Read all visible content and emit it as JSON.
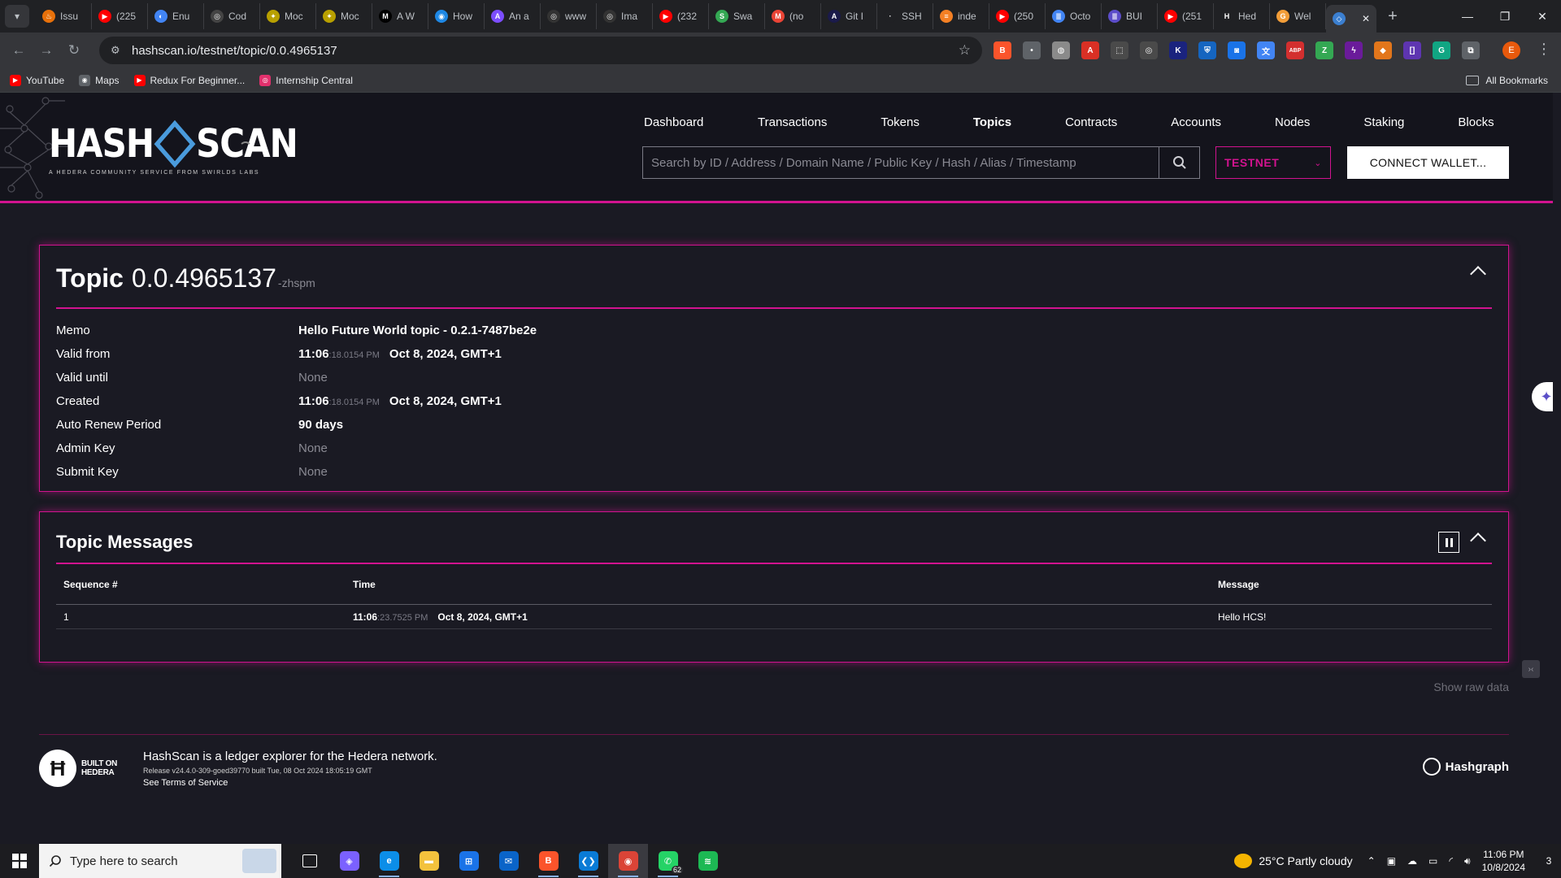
{
  "browser": {
    "tabs": [
      {
        "label": "Issu",
        "color": "#e8710a",
        "glyph": "♨"
      },
      {
        "label": "(225",
        "color": "#ff0000",
        "glyph": "▶"
      },
      {
        "label": "Enu",
        "color": "#4285f4",
        "glyph": "◐"
      },
      {
        "label": "Cod",
        "color": "#444444",
        "glyph": "◎"
      },
      {
        "label": "Moc",
        "color": "#b8a000",
        "glyph": "✦"
      },
      {
        "label": "Moc",
        "color": "#b8a000",
        "glyph": "✦"
      },
      {
        "label": "A W",
        "color": "#000000",
        "glyph": "M"
      },
      {
        "label": "How",
        "color": "#1e88e5",
        "glyph": "◉"
      },
      {
        "label": "An a",
        "color": "#7c4dff",
        "glyph": "A"
      },
      {
        "label": "www",
        "color": "#333333",
        "glyph": "◎"
      },
      {
        "label": "Ima",
        "color": "#333333",
        "glyph": "◎"
      },
      {
        "label": "(232",
        "color": "#ff0000",
        "glyph": "▶"
      },
      {
        "label": "Swa",
        "color": "#34a853",
        "glyph": "S"
      },
      {
        "label": "(no",
        "color": "#ea4335",
        "glyph": "M"
      },
      {
        "label": "Git I",
        "color": "#1a1a4a",
        "glyph": "A"
      },
      {
        "label": "SSH",
        "color": "#202124",
        "glyph": "·"
      },
      {
        "label": "inde",
        "color": "#f48024",
        "glyph": "≡"
      },
      {
        "label": "(250",
        "color": "#ff0000",
        "glyph": "▶"
      },
      {
        "label": "Octo",
        "color": "#4285f4",
        "glyph": "≣"
      },
      {
        "label": "BUI",
        "color": "#5c4dc9",
        "glyph": "≣"
      },
      {
        "label": "(251",
        "color": "#ff0000",
        "glyph": "▶"
      },
      {
        "label": "Hed",
        "color": "#202124",
        "glyph": "H"
      },
      {
        "label": "Wel",
        "color": "#f29d38",
        "glyph": "G"
      },
      {
        "label": "",
        "color": "#3b7fd0",
        "glyph": "◇"
      }
    ],
    "url": "hashscan.io/testnet/topic/0.0.4965137",
    "bookmarks": [
      {
        "label": "YouTube",
        "color": "#ff0000",
        "glyph": "▶"
      },
      {
        "label": "Maps",
        "color": "#5f6368",
        "glyph": "◉"
      },
      {
        "label": "Redux For Beginner...",
        "color": "#ff0000",
        "glyph": "▶"
      },
      {
        "label": "Internship Central",
        "color": "#e1306c",
        "glyph": "◎"
      }
    ],
    "all_bookmarks": "All Bookmarks",
    "extensions": [
      {
        "name": "brave-icon",
        "color": "#fb542b",
        "glyph": "B"
      },
      {
        "name": "extension-dot-icon",
        "color": "#5f6368",
        "glyph": "•"
      },
      {
        "name": "globe-extension-icon",
        "color": "#8a8a8a",
        "glyph": "◍"
      },
      {
        "name": "pdf-icon",
        "color": "#d93025",
        "glyph": "A"
      },
      {
        "name": "screenshot-icon",
        "color": "#4a4a4a",
        "glyph": "⬚"
      },
      {
        "name": "target-icon",
        "color": "#4a4a4a",
        "glyph": "◎"
      },
      {
        "name": "code-extension-icon",
        "color": "#1a237e",
        "glyph": "K"
      },
      {
        "name": "shield-extension-icon",
        "color": "#1565c0",
        "glyph": "⛨"
      },
      {
        "name": "camera-extension-icon",
        "color": "#1a73e8",
        "glyph": "◙"
      },
      {
        "name": "translate-icon",
        "color": "#4285f4",
        "glyph": "文"
      },
      {
        "name": "adblock-icon",
        "color": "#d32f2f",
        "glyph": "ABP"
      },
      {
        "name": "tracker-extension-icon",
        "color": "#34a853",
        "glyph": "Z"
      },
      {
        "name": "lightning-extension-icon",
        "color": "#6a1b9a",
        "glyph": "ϟ"
      },
      {
        "name": "metamask-icon",
        "color": "#e2761b",
        "glyph": "◆"
      },
      {
        "name": "bracket-extension-icon",
        "color": "#5e35b1",
        "glyph": "[]"
      },
      {
        "name": "grammarly-icon",
        "color": "#11a683",
        "glyph": "G"
      },
      {
        "name": "extensions-puzzle-icon",
        "color": "#5f6368",
        "glyph": "⧉"
      }
    ],
    "profile_initial": "E"
  },
  "site": {
    "logo_word1": "HASH",
    "logo_word2": "SCAN",
    "logo_tagline": "A HEDERA COMMUNITY SERVICE FROM SWIRLDS LABS",
    "nav": [
      "Dashboard",
      "Transactions",
      "Tokens",
      "Topics",
      "Contracts",
      "Accounts",
      "Nodes",
      "Staking",
      "Blocks"
    ],
    "active_nav": "Topics",
    "search_placeholder": "Search by ID / Address / Domain Name / Public Key / Hash / Alias / Timestamp",
    "network": "TESTNET",
    "connect_label": "CONNECT WALLET...",
    "accent": "#d1138f"
  },
  "topic": {
    "title_word": "Topic",
    "id": "0.0.4965137",
    "checksum": "-zhspm",
    "memo_label": "Memo",
    "memo_value": "Hello Future World topic - 0.2.1-7487be2e",
    "valid_from_label": "Valid from",
    "valid_from_time": "11:06",
    "valid_from_sub": ":18.0154 PM",
    "valid_from_date": "Oct 8, 2024, GMT+1",
    "valid_until_label": "Valid until",
    "valid_until_value": "None",
    "created_label": "Created",
    "created_time": "11:06",
    "created_sub": ":18.0154 PM",
    "created_date": "Oct 8, 2024, GMT+1",
    "renew_label": "Auto Renew Period",
    "renew_value": "90 days",
    "admin_label": "Admin Key",
    "admin_value": "None",
    "submit_label": "Submit Key",
    "submit_value": "None"
  },
  "messages": {
    "title": "Topic Messages",
    "col_seq": "Sequence #",
    "col_time": "Time",
    "col_msg": "Message",
    "rows": [
      {
        "seq": "1",
        "time": "11:06",
        "time_sub": ":23.7525 PM",
        "date": "Oct 8, 2024, GMT+1",
        "message": "Hello HCS!"
      }
    ]
  },
  "show_raw": "Show raw data",
  "footer": {
    "built_on_1": "BUILT ON",
    "built_on_2": "HEDERA",
    "main": "HashScan is a ledger explorer for the Hedera network.",
    "release": "Release v24.4.0-309-goed39770 built Tue, 08 Oct 2024 18:05:19 GMT",
    "terms": "See Terms of Service",
    "hashgraph": "Hashgraph"
  },
  "taskbar": {
    "search_placeholder": "Type here to search",
    "apps": [
      {
        "name": "task-view-icon",
        "color": "#1c1c20",
        "glyph": "⧉"
      },
      {
        "name": "copilot-icon",
        "color": "#7b61ff",
        "glyph": "◈"
      },
      {
        "name": "edge-icon",
        "color": "#0c8ee8",
        "glyph": "e"
      },
      {
        "name": "file-explorer-icon",
        "color": "#f3c23d",
        "glyph": "▬"
      },
      {
        "name": "store-icon",
        "color": "#1a73e8",
        "glyph": "⊞"
      },
      {
        "name": "mail-icon",
        "color": "#0a64c8",
        "glyph": "✉"
      },
      {
        "name": "brave-browser-icon",
        "color": "#fb542b",
        "glyph": "B"
      },
      {
        "name": "vscode-icon",
        "color": "#0a7bd6",
        "glyph": "❮❯"
      },
      {
        "name": "chrome-icon",
        "color": "#db4437",
        "glyph": "◉"
      },
      {
        "name": "whatsapp-icon",
        "color": "#25d366",
        "glyph": "✆"
      },
      {
        "name": "spotify-icon",
        "color": "#1db954",
        "glyph": "≋"
      }
    ],
    "whatsapp_badge": "62",
    "weather": "25°C  Partly cloudy",
    "time": "11:06 PM",
    "date": "10/8/2024",
    "notifications": "3"
  }
}
